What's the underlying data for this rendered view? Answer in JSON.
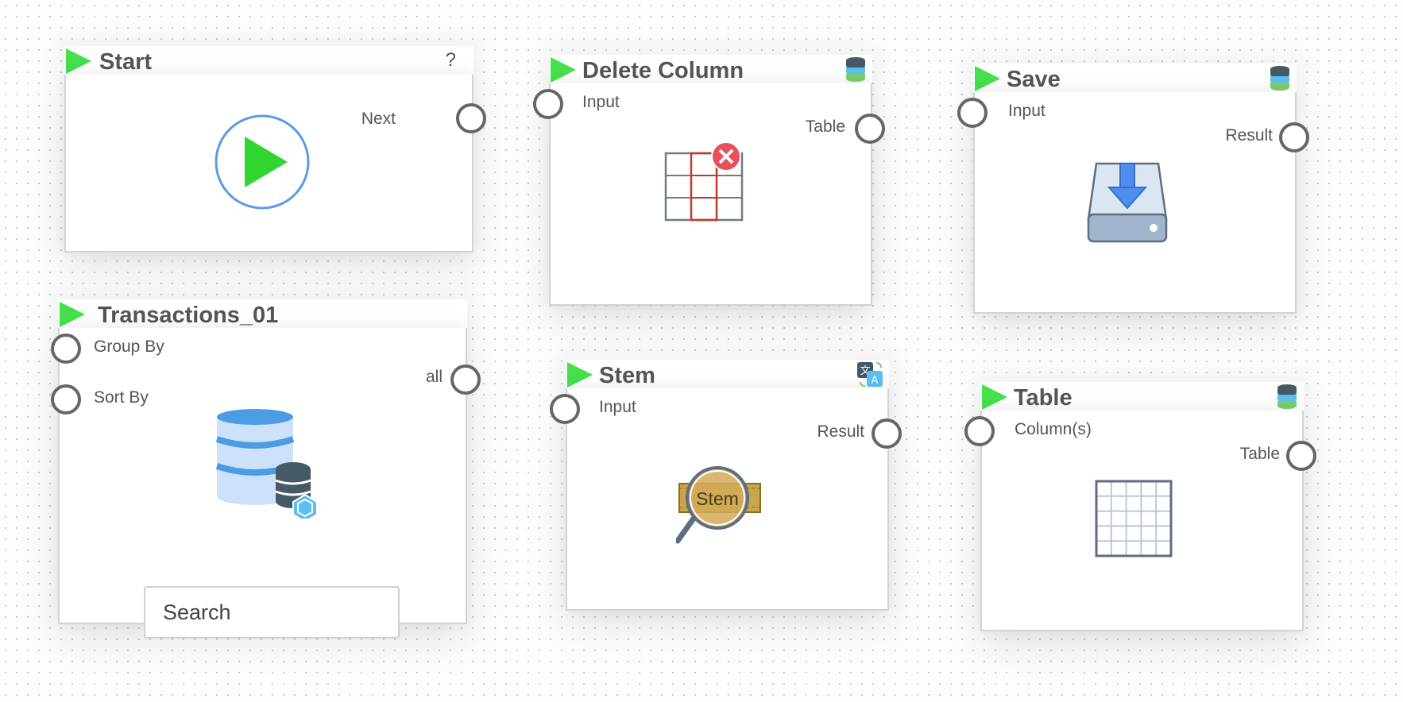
{
  "canvas": {
    "nodes": {
      "start": {
        "title": "Start",
        "help": "?",
        "output_port": "Next",
        "icon": "play-circle-icon"
      },
      "delete_column": {
        "title": "Delete Column",
        "input_port": "Input",
        "output_port": "Table",
        "icon": "delete-column-table-icon",
        "header_icon": "database-stack-icon"
      },
      "save": {
        "title": "Save",
        "input_port": "Input",
        "output_port": "Result",
        "icon": "save-drive-icon",
        "header_icon": "database-stack-icon"
      },
      "transactions": {
        "title": "Transactions_01",
        "input_ports": [
          "Group By",
          "Sort By"
        ],
        "output_port": "all",
        "icon": "database-icon",
        "search_placeholder": "Search"
      },
      "stem": {
        "title": "Stem",
        "input_port": "Input",
        "output_port": "Result",
        "icon": "stem-magnifier-icon",
        "icon_text": "Stem",
        "header_icon": "translate-icon"
      },
      "table": {
        "title": "Table",
        "input_port": "Column(s)",
        "output_port": "Table",
        "icon": "table-grid-icon",
        "header_icon": "database-stack-icon"
      }
    }
  },
  "colors": {
    "run": "#45e04c",
    "port_border": "#666666",
    "title": "#555555",
    "accent_blue": "#4a90e2",
    "delete_red": "#e8505b"
  }
}
